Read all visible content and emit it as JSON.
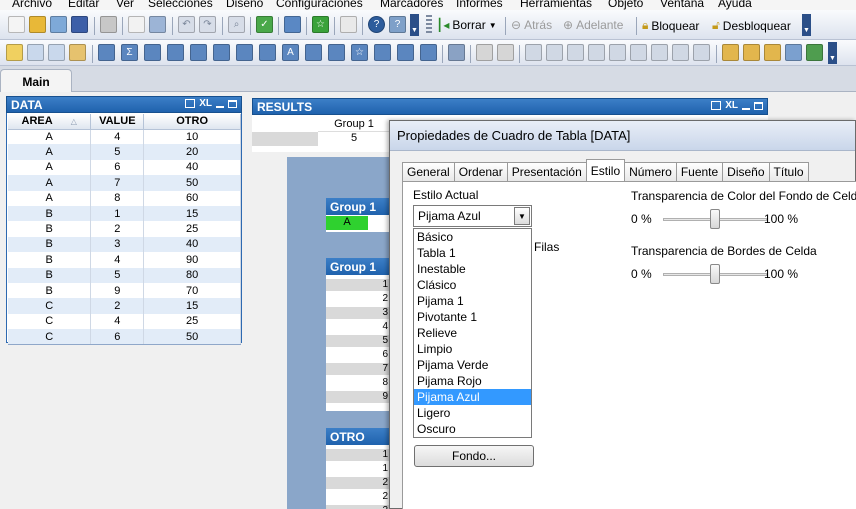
{
  "menu": [
    "Archivo",
    "Editar",
    "Ver",
    "Selecciones",
    "Diseño",
    "Configuraciones",
    "Marcadores",
    "Informes",
    "Herramientas",
    "Objeto",
    "Ventana",
    "Ayuda"
  ],
  "toolbar": {
    "clear_label": "Borrar",
    "back_label": "Atrás",
    "forward_label": "Adelante",
    "lock_label": "Bloquear",
    "unlock_label": "Desbloquear"
  },
  "sheet_tabs": [
    {
      "label": "Main",
      "active": true
    }
  ],
  "data_box": {
    "title": "DATA",
    "xl_label": "XL",
    "columns": [
      "AREA",
      "VALUE",
      "OTRO"
    ],
    "rows": [
      [
        "A",
        "4",
        "10"
      ],
      [
        "A",
        "5",
        "20"
      ],
      [
        "A",
        "6",
        "40"
      ],
      [
        "A",
        "7",
        "50"
      ],
      [
        "A",
        "8",
        "60"
      ],
      [
        "B",
        "1",
        "15"
      ],
      [
        "B",
        "2",
        "25"
      ],
      [
        "B",
        "3",
        "40"
      ],
      [
        "B",
        "4",
        "90"
      ],
      [
        "B",
        "5",
        "80"
      ],
      [
        "B",
        "9",
        "70"
      ],
      [
        "C",
        "2",
        "15"
      ],
      [
        "C",
        "4",
        "25"
      ],
      [
        "C",
        "6",
        "50"
      ]
    ]
  },
  "results_box": {
    "title": "RESULTS",
    "xl_label": "XL",
    "column_header": "Group 1",
    "value": "5"
  },
  "background_objects": {
    "group1_a_title": "Group 1",
    "group1_a_cell": "A",
    "group1_b_title": "Group 1",
    "group1_b_values": [
      "1",
      "2",
      "3",
      "4",
      "5",
      "6",
      "7",
      "8",
      "9"
    ],
    "otro_title": "OTRO",
    "otro_values": [
      "1",
      "1",
      "2",
      "2",
      "2"
    ]
  },
  "dialog": {
    "title": "Propiedades de Cuadro de Tabla [DATA]",
    "tabs": [
      {
        "label": "General",
        "active": false
      },
      {
        "label": "Ordenar",
        "active": false
      },
      {
        "label": "Presentación",
        "active": false
      },
      {
        "label": "Estilo",
        "active": true
      },
      {
        "label": "Número",
        "active": false
      },
      {
        "label": "Fuente",
        "active": false
      },
      {
        "label": "Diseño",
        "active": false
      },
      {
        "label": "Título",
        "active": false
      }
    ],
    "current_style_label": "Estilo Actual",
    "current_style_value": "Pijama Azul",
    "style_options": [
      "Básico",
      "Tabla 1",
      "Inestable",
      "Clásico",
      "Pijama 1",
      "Pivotante 1",
      "Relieve",
      "Limpio",
      "Pijama Verde",
      "Pijama Rojo",
      "Pijama Azul",
      "Ligero",
      "Oscuro"
    ],
    "selected_option": "Pijama Azul",
    "hidden_label_fragment": "Filas",
    "cell_bg_transparency_label": "Transparencia de Color del Fondo de Celda",
    "cell_border_transparency_label": "Transparencia de Bordes de Celda",
    "min_label": "0 %",
    "max_label": "100 %",
    "bg_slider_value": 0.5,
    "border_slider_value": 0.5,
    "background_button_label": "Fondo..."
  }
}
